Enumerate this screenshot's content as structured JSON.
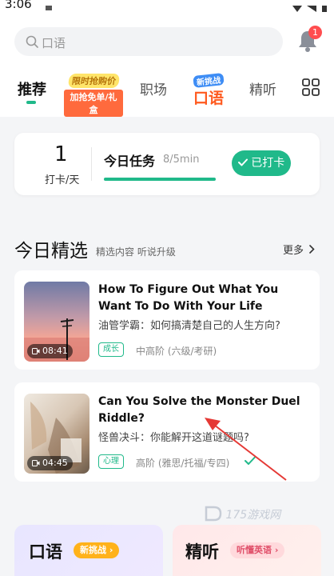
{
  "status_bar": {
    "time": "3:06"
  },
  "search": {
    "placeholder": "口语"
  },
  "notifications": {
    "count": "1"
  },
  "tabs": [
    {
      "label": "推荐"
    },
    {
      "promo_line1": "限时抢购价",
      "promo_line2": "加抢免单/礼盒"
    },
    {
      "label": "职场"
    },
    {
      "promo_line1": "新挑战",
      "promo_line2": "口语"
    },
    {
      "label": "精听"
    }
  ],
  "checkin": {
    "days": "1",
    "unit": "打卡/天",
    "task_label": "今日任务",
    "task_progress": "8/5min",
    "progress_fraction": 1.0,
    "button_label": "已打卡"
  },
  "section": {
    "title": "今日精选",
    "subtitle": "精选内容 听说升级",
    "more_label": "更多"
  },
  "courses": [
    {
      "title": "How To Figure Out What You Want To Do With Your Life",
      "subtitle": "油管学霸：如何搞清楚自己的人生方向?",
      "tag": "成长",
      "level": "中高阶 (六级/考研)",
      "duration": "08:41"
    },
    {
      "title": "Can You Solve the Monster Duel Riddle?",
      "subtitle": "怪兽决斗：你能解开这道谜题吗?",
      "tag": "心理",
      "level": "高阶 (雅思/托福/专四)",
      "duration": "04:45",
      "completed": true
    }
  ],
  "watermark": "175游戏网",
  "bottom_cards": [
    {
      "title": "口语",
      "pill": "新挑战"
    },
    {
      "title": "精听",
      "pill": "听懂英语"
    }
  ],
  "colors": {
    "accent": "#20b98a",
    "badge": "#ff4d4f"
  }
}
